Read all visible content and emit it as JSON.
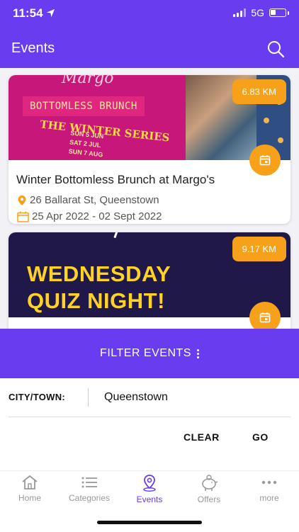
{
  "status": {
    "time": "11:54",
    "network": "5G"
  },
  "header": {
    "title": "Events"
  },
  "events": [
    {
      "title": "Winter Bottomless Brunch at Margo's",
      "location": "26 Ballarat St, Queenstown",
      "dates": "25 Apr 2022 - 02 Sept 2022",
      "distance": "6.83 KM",
      "image_text": {
        "logo": "Margo",
        "banner": "BOTTOMLESS BRUNCH",
        "series": "THE WINTER SERIES",
        "lines": [
          "SUN 5 JUN",
          "SAT 2 JUL",
          "SUN 7 AUG"
        ]
      }
    },
    {
      "distance": "9.17 KM",
      "image_text": {
        "line1": "WEDNESDAY",
        "line2": "QUIZ NIGHT!"
      }
    }
  ],
  "filter": {
    "toggle_label": "FILTER EVENTS",
    "city_label": "CITY/TOWN:",
    "city_value": "Queenstown",
    "clear_label": "CLEAR",
    "go_label": "GO"
  },
  "tabs": [
    {
      "label": "Home",
      "icon": "home-icon"
    },
    {
      "label": "Categories",
      "icon": "list-icon"
    },
    {
      "label": "Events",
      "icon": "map-pin-icon",
      "active": true
    },
    {
      "label": "Offers",
      "icon": "piggy-bank-icon"
    },
    {
      "label": "more",
      "icon": "more-dots-icon"
    }
  ],
  "colors": {
    "primary": "#6a3cf0",
    "accent": "#f7a11a"
  }
}
